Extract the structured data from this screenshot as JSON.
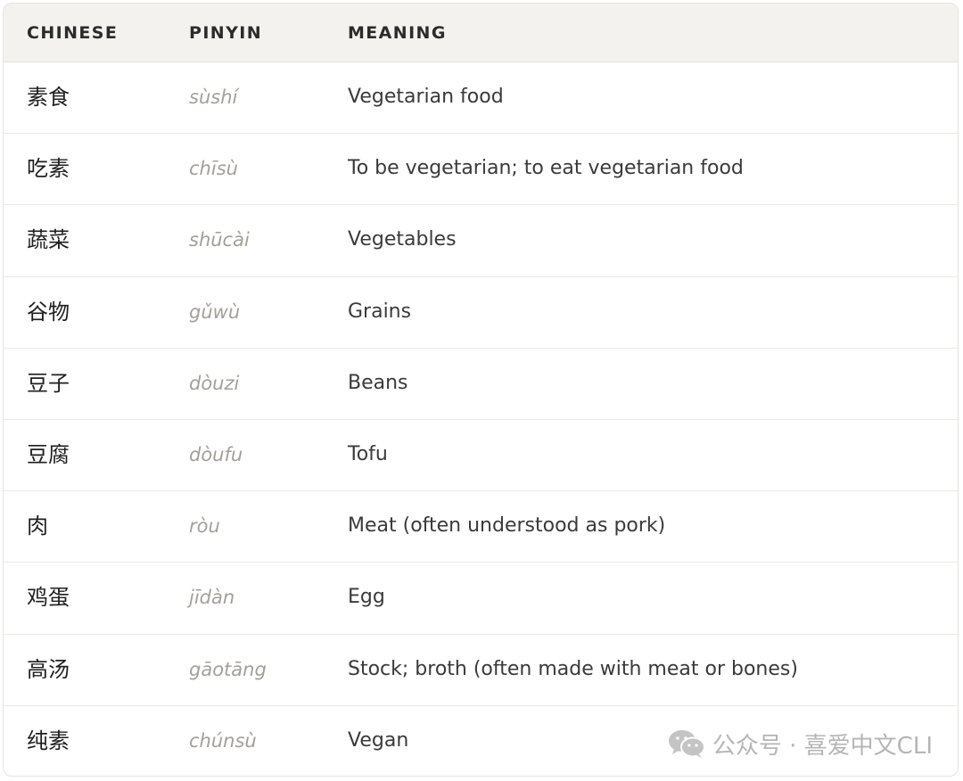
{
  "header": {
    "chinese": "CHINESE",
    "pinyin": "PINYIN",
    "meaning": "MEANING"
  },
  "rows": [
    {
      "chinese": "素食",
      "pinyin": "sùshí",
      "meaning": "Vegetarian food"
    },
    {
      "chinese": "吃素",
      "pinyin": "chīsù",
      "meaning": "To be vegetarian; to eat vegetarian food"
    },
    {
      "chinese": "蔬菜",
      "pinyin": "shūcài",
      "meaning": "Vegetables"
    },
    {
      "chinese": "谷物",
      "pinyin": "gǔwù",
      "meaning": "Grains"
    },
    {
      "chinese": "豆子",
      "pinyin": "dòuzi",
      "meaning": "Beans"
    },
    {
      "chinese": "豆腐",
      "pinyin": "dòufu",
      "meaning": "Tofu"
    },
    {
      "chinese": "肉",
      "pinyin": "ròu",
      "meaning": "Meat (often understood as pork)"
    },
    {
      "chinese": "鸡蛋",
      "pinyin": "jīdàn",
      "meaning": "Egg"
    },
    {
      "chinese": "高汤",
      "pinyin": "gāotāng",
      "meaning": "Stock; broth (often made with meat or bones)"
    },
    {
      "chinese": "纯素",
      "pinyin": "chúnsù",
      "meaning": "Vegan"
    }
  ],
  "watermark": {
    "icon": "wechat-icon",
    "text": "公众号 · 喜爱中文CLI"
  }
}
